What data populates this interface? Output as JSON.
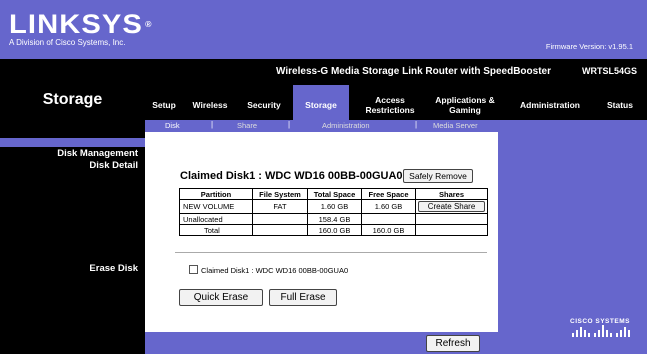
{
  "header": {
    "logo": "LINKSYS",
    "logo_mark": "®",
    "division": "A Division of Cisco Systems, Inc.",
    "firmware": "Firmware Version: v1.95.1"
  },
  "product": {
    "name": "Wireless-G Media Storage Link Router with SpeedBooster",
    "model": "WRTSL54GS"
  },
  "page_title": "Storage",
  "tabs": [
    {
      "label": "Setup"
    },
    {
      "label": "Wireless"
    },
    {
      "label": "Security"
    },
    {
      "label": "Storage"
    },
    {
      "label": "Access Restrictions"
    },
    {
      "label": "Applications & Gaming"
    },
    {
      "label": "Administration"
    },
    {
      "label": "Status"
    }
  ],
  "subtabs": [
    {
      "label": "Disk"
    },
    {
      "label": "Share"
    },
    {
      "label": "Administration"
    },
    {
      "label": "Media Server"
    }
  ],
  "left": {
    "section": "Disk Management",
    "disk_detail": "Disk Detail",
    "erase_disk": "Erase Disk"
  },
  "disk": {
    "title": "Claimed Disk1 : WDC WD16 00BB-00GUA0",
    "safely_remove": "Safely Remove",
    "headers": [
      "Partition",
      "File System",
      "Total Space",
      "Free Space",
      "Shares"
    ],
    "rows": [
      {
        "partition": "NEW VOLUME",
        "fs": "FAT",
        "total": "1.60 GB",
        "free": "1.60 GB",
        "share": "Create Share"
      },
      {
        "partition": "Unallocated",
        "fs": "",
        "total": "158.4 GB",
        "free": "",
        "share": ""
      },
      {
        "partition": "Total",
        "fs": "",
        "total": "160.0 GB",
        "free": "160.0 GB",
        "share": ""
      }
    ]
  },
  "erase": {
    "checkbox_label": "Claimed Disk1 : WDC WD16 00BB-00GUA0",
    "quick_erase": "Quick Erase",
    "full_erase": "Full Erase"
  },
  "refresh": "Refresh",
  "cisco": "Cisco Systems",
  "colors": {
    "accent": "#6666cc",
    "black": "#000000"
  }
}
